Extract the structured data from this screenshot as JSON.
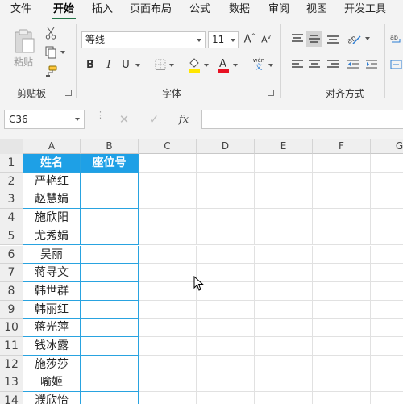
{
  "menu": {
    "tabs": [
      "文件",
      "开始",
      "插入",
      "页面布局",
      "公式",
      "数据",
      "审阅",
      "视图",
      "开发工具"
    ],
    "active_index": 1
  },
  "ribbon": {
    "clipboard": {
      "paste_label": "粘贴",
      "group_label": "剪贴板"
    },
    "font": {
      "font_name": "等线",
      "font_size": "11",
      "bold": "B",
      "italic": "I",
      "underline": "U",
      "group_label": "字体",
      "font_color": "#e81123",
      "fill_color": "#ffe600",
      "wen_top": "wén",
      "wen_bottom": "文"
    },
    "alignment": {
      "group_label": "对齐方式"
    }
  },
  "formula_bar": {
    "name_box": "C36",
    "fx_label": "fx",
    "formula": ""
  },
  "sheet": {
    "columns": [
      "A",
      "B",
      "C",
      "D",
      "E",
      "F",
      "G"
    ],
    "rows": [
      "1",
      "2",
      "3",
      "4",
      "5",
      "6",
      "7",
      "8",
      "9",
      "10",
      "11",
      "12",
      "13",
      "14"
    ],
    "header": {
      "A": "姓名",
      "B": "座位号"
    },
    "names": [
      "严艳红",
      "赵慧娟",
      "施欣阳",
      "尤秀娟",
      "吴丽",
      "蒋寻文",
      "韩世群",
      "韩丽红",
      "蒋光萍",
      "钱冰露",
      "施莎莎",
      "喻姬",
      "濮欣怡"
    ],
    "header_fill": "#1ea0e6"
  }
}
